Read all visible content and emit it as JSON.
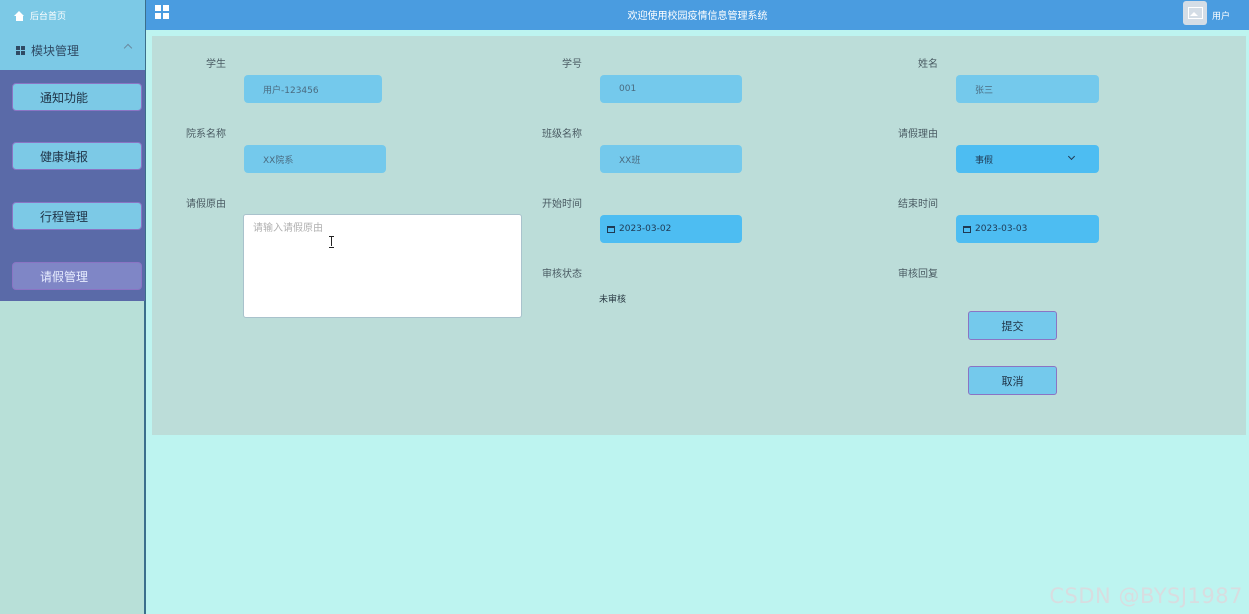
{
  "sidebar": {
    "home_label": "后台首页",
    "module_label": "模块管理",
    "menu": [
      {
        "label": "通知功能"
      },
      {
        "label": "健康填报"
      },
      {
        "label": "行程管理"
      },
      {
        "label": "请假管理"
      }
    ]
  },
  "header": {
    "title": "欢迎使用校园疫情信息管理系统",
    "user_label": "用户"
  },
  "form": {
    "student_label": "学生",
    "student_value": "用户-123456",
    "id_label": "学号",
    "id_value": "001",
    "name_label": "姓名",
    "name_value": "张三",
    "dept_label": "院系名称",
    "dept_value": "XX院系",
    "class_label": "班级名称",
    "class_value": "XX班",
    "leave_type_label": "请假理由",
    "leave_type_value": "事假",
    "reason_label": "请假原由",
    "reason_placeholder": "请输入请假原由",
    "start_label": "开始时间",
    "start_value": "2023-03-02",
    "end_label": "结束时间",
    "end_value": "2023-03-03",
    "audit_status_label": "审核状态",
    "audit_status_value": "未审核",
    "audit_reply_label": "审核回复",
    "submit_label": "提交",
    "cancel_label": "取消"
  },
  "watermark": "CSDN @BYSJ1987",
  "colors": {
    "header": "#4a9ce0",
    "sidebar_menu": "#5a6aa8",
    "panel": "#bcddd9",
    "field": "#74c9ec",
    "page_bg": "#bdf4f0"
  }
}
